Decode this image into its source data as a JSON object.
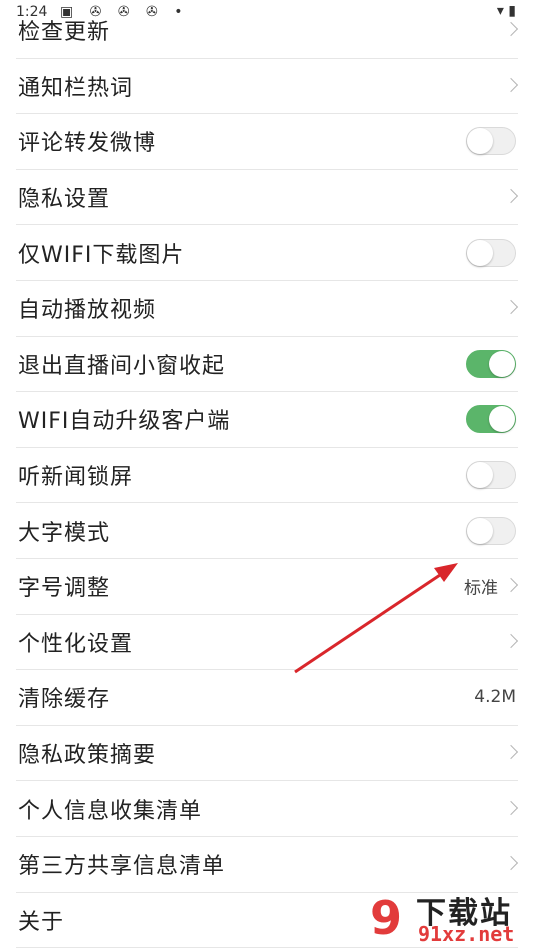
{
  "status_bar": {
    "time": "1:24",
    "icons": "▣ ✇ ✇ ✇ •",
    "right_icons": "▾ ▮"
  },
  "settings": [
    {
      "label": "检查更新",
      "control": "arrow"
    },
    {
      "label": "通知栏热词",
      "control": "arrow"
    },
    {
      "label": "评论转发微博",
      "control": "toggle",
      "on": false
    },
    {
      "label": "隐私设置",
      "control": "arrow"
    },
    {
      "label": "仅WIFI下载图片",
      "control": "toggle",
      "on": false
    },
    {
      "label": "自动播放视频",
      "control": "arrow"
    },
    {
      "label": "退出直播间小窗收起",
      "control": "toggle",
      "on": true
    },
    {
      "label": "WIFI自动升级客户端",
      "control": "toggle",
      "on": true
    },
    {
      "label": "听新闻锁屏",
      "control": "toggle",
      "on": false
    },
    {
      "label": "大字模式",
      "control": "toggle",
      "on": false
    },
    {
      "label": "字号调整",
      "control": "value-arrow",
      "value": "标准"
    },
    {
      "label": "个性化设置",
      "control": "arrow"
    },
    {
      "label": "清除缓存",
      "control": "value",
      "value": "4.2M"
    },
    {
      "label": "隐私政策摘要",
      "control": "arrow"
    },
    {
      "label": "个人信息收集清单",
      "control": "arrow"
    },
    {
      "label": "第三方共享信息清单",
      "control": "arrow"
    },
    {
      "label": "关于",
      "control": "none"
    }
  ],
  "colors": {
    "toggle_on": "#5bb56a",
    "annotation_arrow": "#d9262b",
    "watermark": "#e23b3b"
  },
  "watermark": {
    "logo_char": "9",
    "title": "下载站",
    "domain": "91xz.net"
  }
}
